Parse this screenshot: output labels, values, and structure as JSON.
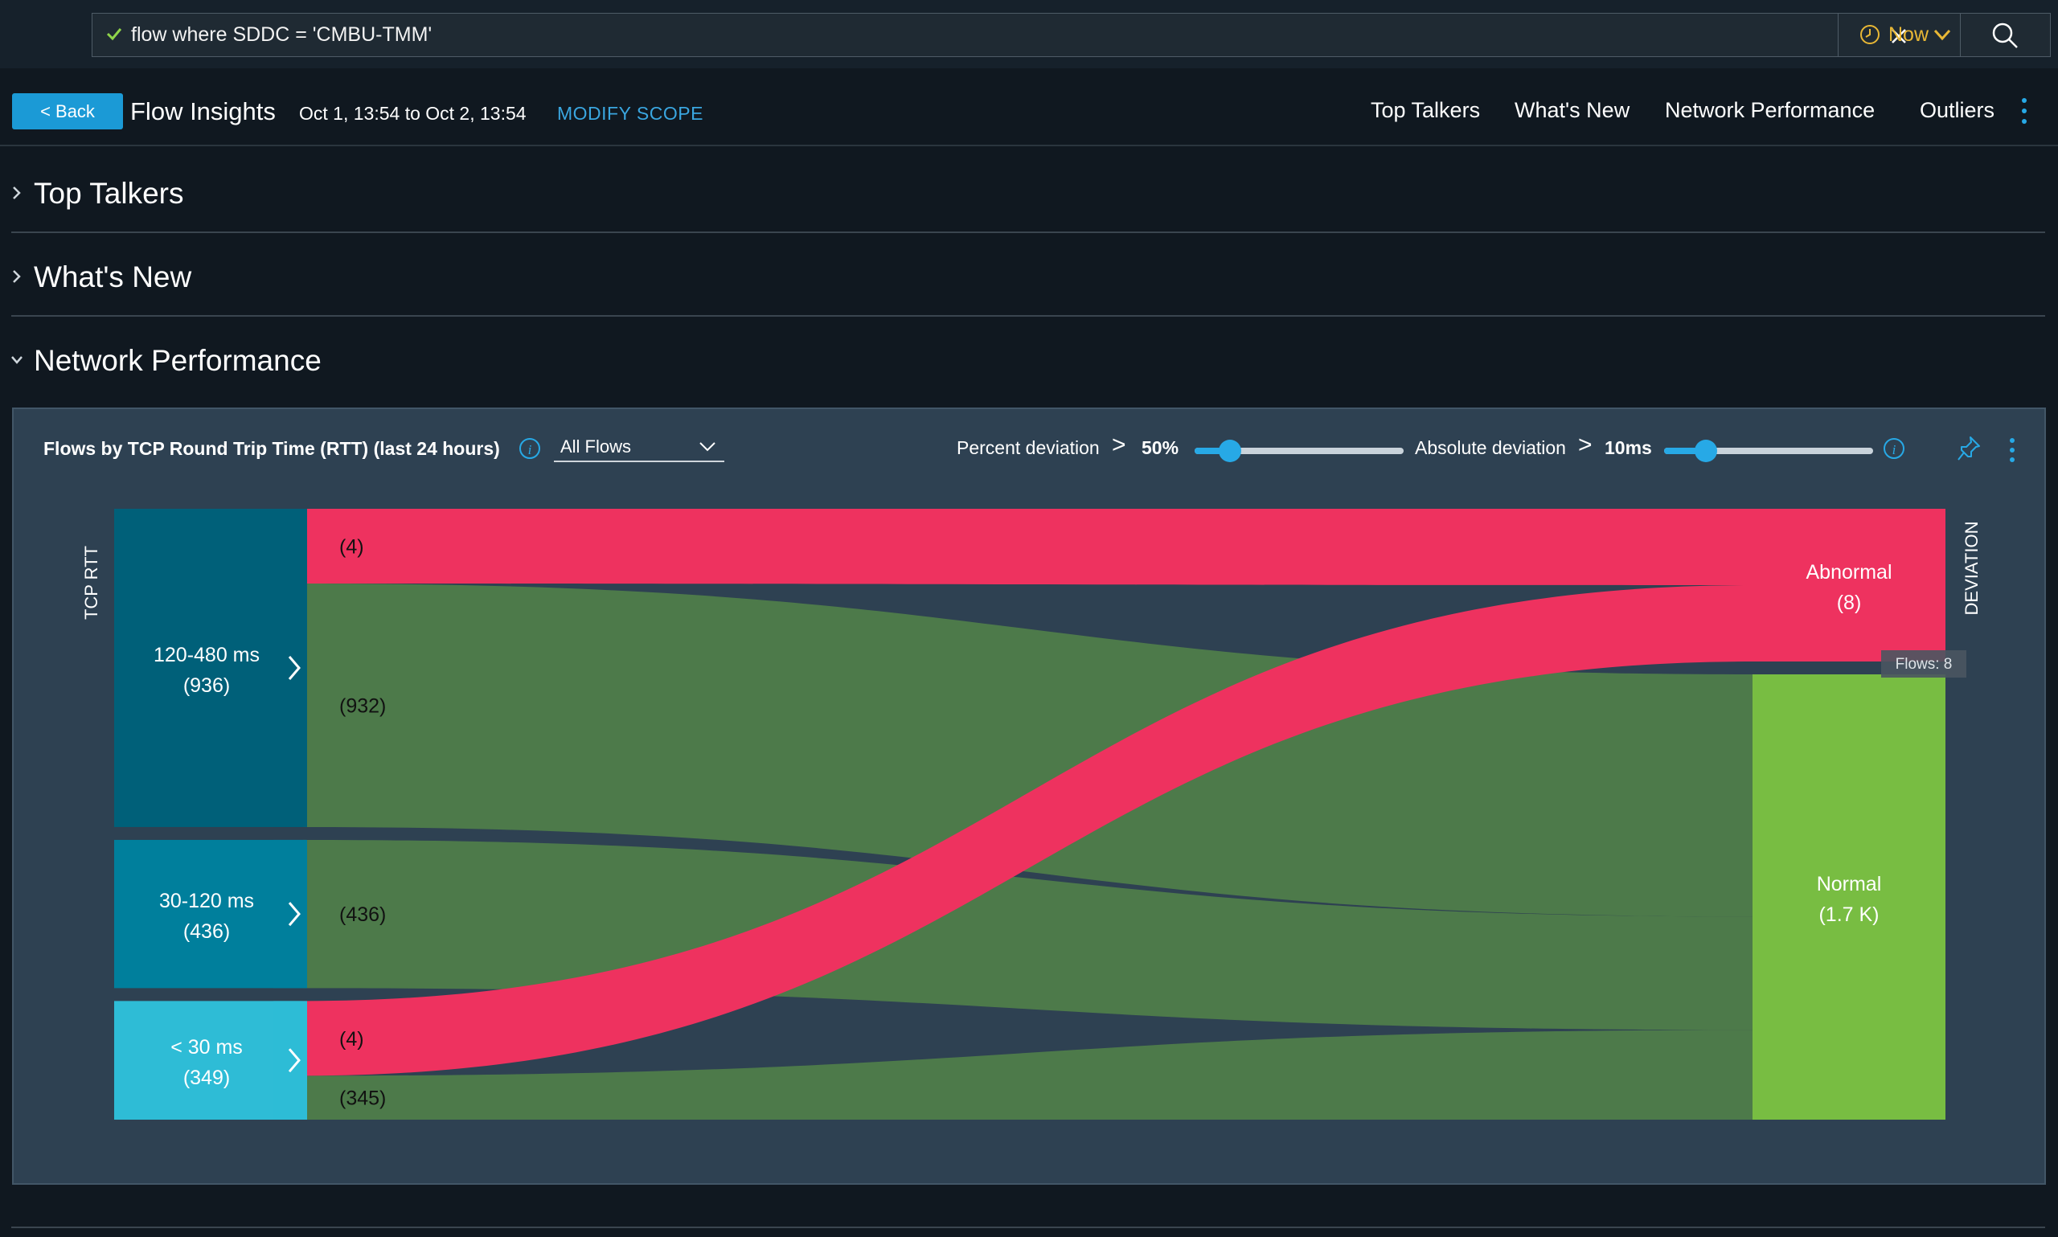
{
  "search": {
    "query": "flow where SDDC = 'CMBU-TMM'",
    "time_label": "Now"
  },
  "header": {
    "back_label": "< Back",
    "title": "Flow Insights",
    "date_range": "Oct 1, 13:54 to Oct 2, 13:54",
    "modify_scope": "MODIFY SCOPE",
    "nav": [
      "Top Talkers",
      "What's New",
      "Network Performance",
      "Outliers"
    ]
  },
  "sections": [
    {
      "title": "Top Talkers",
      "expanded": false
    },
    {
      "title": "What's New",
      "expanded": false
    },
    {
      "title": "Network Performance",
      "expanded": true
    }
  ],
  "card": {
    "title": "Flows by TCP Round Trip Time (RTT) (last 24 hours)",
    "flow_filter": "All Flows",
    "percent_deviation": {
      "label": "Percent deviation",
      "op": ">",
      "value": "50%",
      "level": 0.17
    },
    "absolute_deviation": {
      "label": "Absolute deviation",
      "op": ">",
      "value": "10ms",
      "level": 0.2
    }
  },
  "chart_data": {
    "type": "sankey",
    "left_axis_label": "TCP RTT",
    "right_axis_label": "DEVIATION",
    "sources": [
      {
        "name": "120-480 ms",
        "count_label": "(936)",
        "value": 936,
        "color": "#006079"
      },
      {
        "name": "30-120 ms",
        "count_label": "(436)",
        "value": 436,
        "color": "#007f9c"
      },
      {
        "name": "< 30 ms",
        "count_label": "(349)",
        "value": 349,
        "color": "#2ebcd6"
      }
    ],
    "targets": [
      {
        "name": "Abnormal",
        "count_label": "(8)",
        "value": 8,
        "color": "#ee325f"
      },
      {
        "name": "Normal",
        "count_label": "(1.7 K)",
        "value": 1713,
        "color": "#78bd42"
      }
    ],
    "links": [
      {
        "source": "120-480 ms",
        "target": "Abnormal",
        "value": 4,
        "label": "(4)"
      },
      {
        "source": "120-480 ms",
        "target": "Normal",
        "value": 932,
        "label": "(932)"
      },
      {
        "source": "30-120 ms",
        "target": "Normal",
        "value": 436,
        "label": "(436)"
      },
      {
        "source": "< 30 ms",
        "target": "Abnormal",
        "value": 4,
        "label": "(4)"
      },
      {
        "source": "< 30 ms",
        "target": "Normal",
        "value": 345,
        "label": "(345)"
      }
    ],
    "tooltip": "Flows: 8"
  }
}
